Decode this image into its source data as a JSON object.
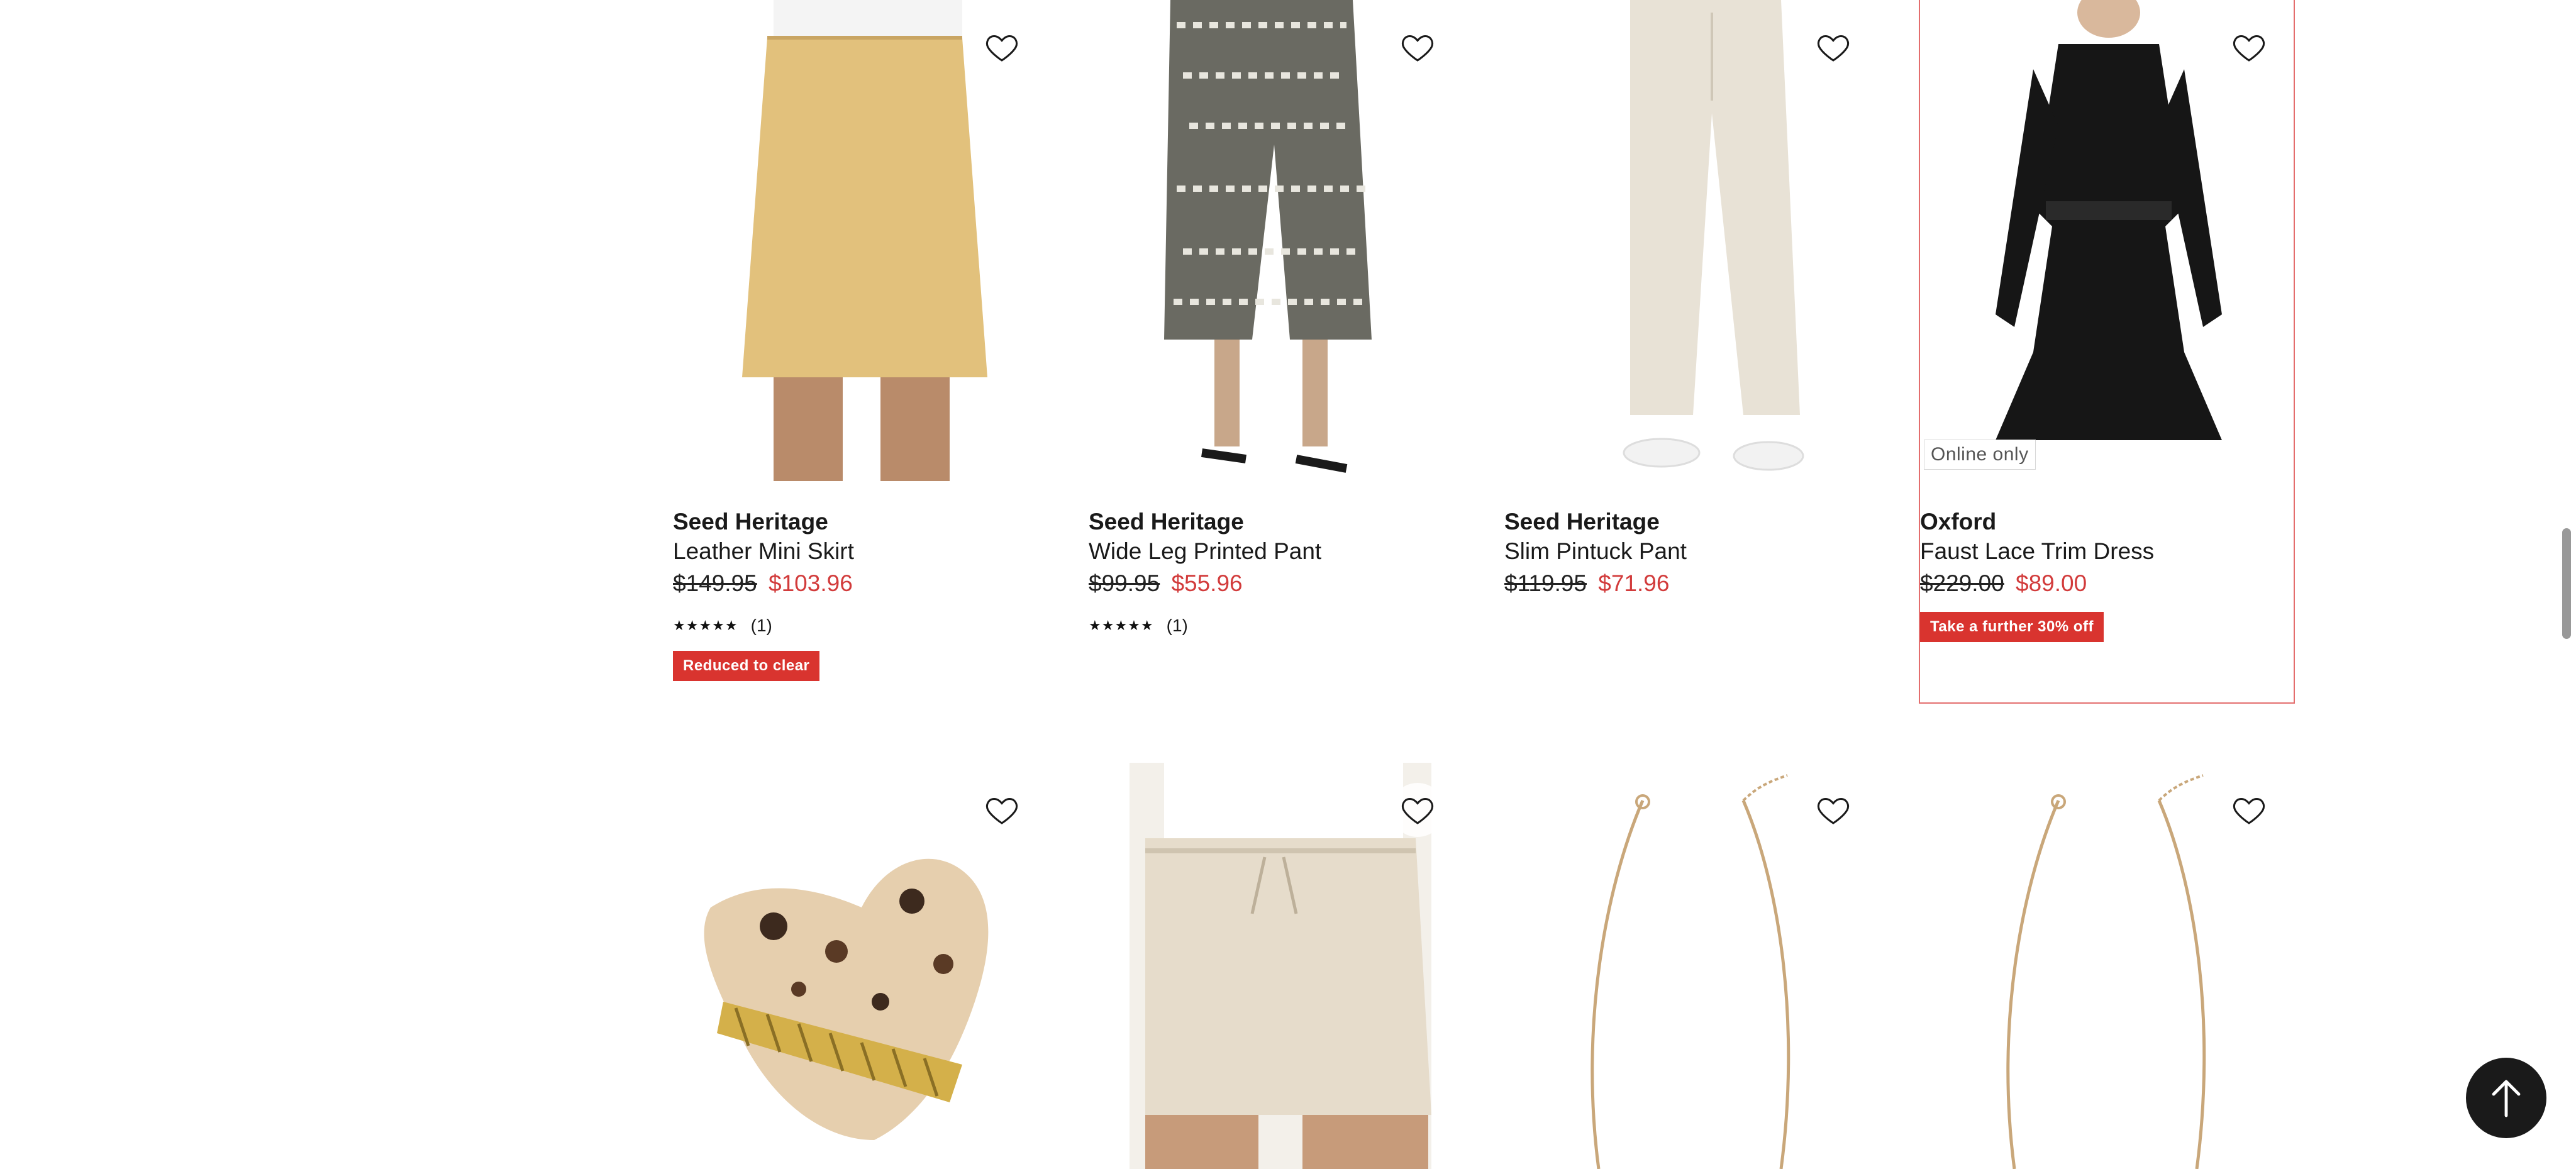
{
  "products": [
    {
      "brand": "Seed Heritage",
      "name": "Leather Mini Skirt",
      "was_price": "$149.95",
      "sale_price": "$103.96",
      "stars": "★★★★★",
      "reviews": "(1)",
      "badge": "Reduced to clear",
      "online_only": "",
      "colors": {
        "main": "#e2c17c",
        "bg": "#ffffff"
      }
    },
    {
      "brand": "Seed Heritage",
      "name": "Wide Leg Printed Pant",
      "was_price": "$99.95",
      "sale_price": "$55.96",
      "stars": "★★★★★",
      "reviews": "(1)",
      "badge": "",
      "online_only": "",
      "colors": {
        "main": "#6a6a62",
        "bg": "#ffffff"
      }
    },
    {
      "brand": "Seed Heritage",
      "name": "Slim Pintuck Pant",
      "was_price": "$119.95",
      "sale_price": "$71.96",
      "stars": "",
      "reviews": "",
      "badge": "",
      "online_only": "",
      "colors": {
        "main": "#e8e2d6",
        "bg": "#ffffff"
      }
    },
    {
      "brand": "Oxford",
      "name": "Faust Lace Trim Dress",
      "was_price": "$229.00",
      "sale_price": "$89.00",
      "stars": "",
      "reviews": "",
      "badge": "Take a further 30% off",
      "online_only": "Online only",
      "colors": {
        "main": "#161616",
        "bg": "#ffffff"
      }
    }
  ],
  "second_row": [
    {
      "item": "claw clip",
      "colors": {
        "main": "#e6cfae"
      }
    },
    {
      "item": "linen shorts",
      "colors": {
        "main": "#e6dccb"
      }
    },
    {
      "item": "gold chain necklace",
      "colors": {
        "main": "#c9a77a"
      }
    },
    {
      "item": "gold chain necklace",
      "colors": {
        "main": "#c9a77a"
      }
    }
  ],
  "accent_colors": {
    "sale": "#d23b3b",
    "highlight_border": "#e46d6d",
    "badge_bg": "#d9342f"
  },
  "icons": {
    "wishlist": "heart-icon",
    "scroll_top": "arrow-up-icon"
  }
}
